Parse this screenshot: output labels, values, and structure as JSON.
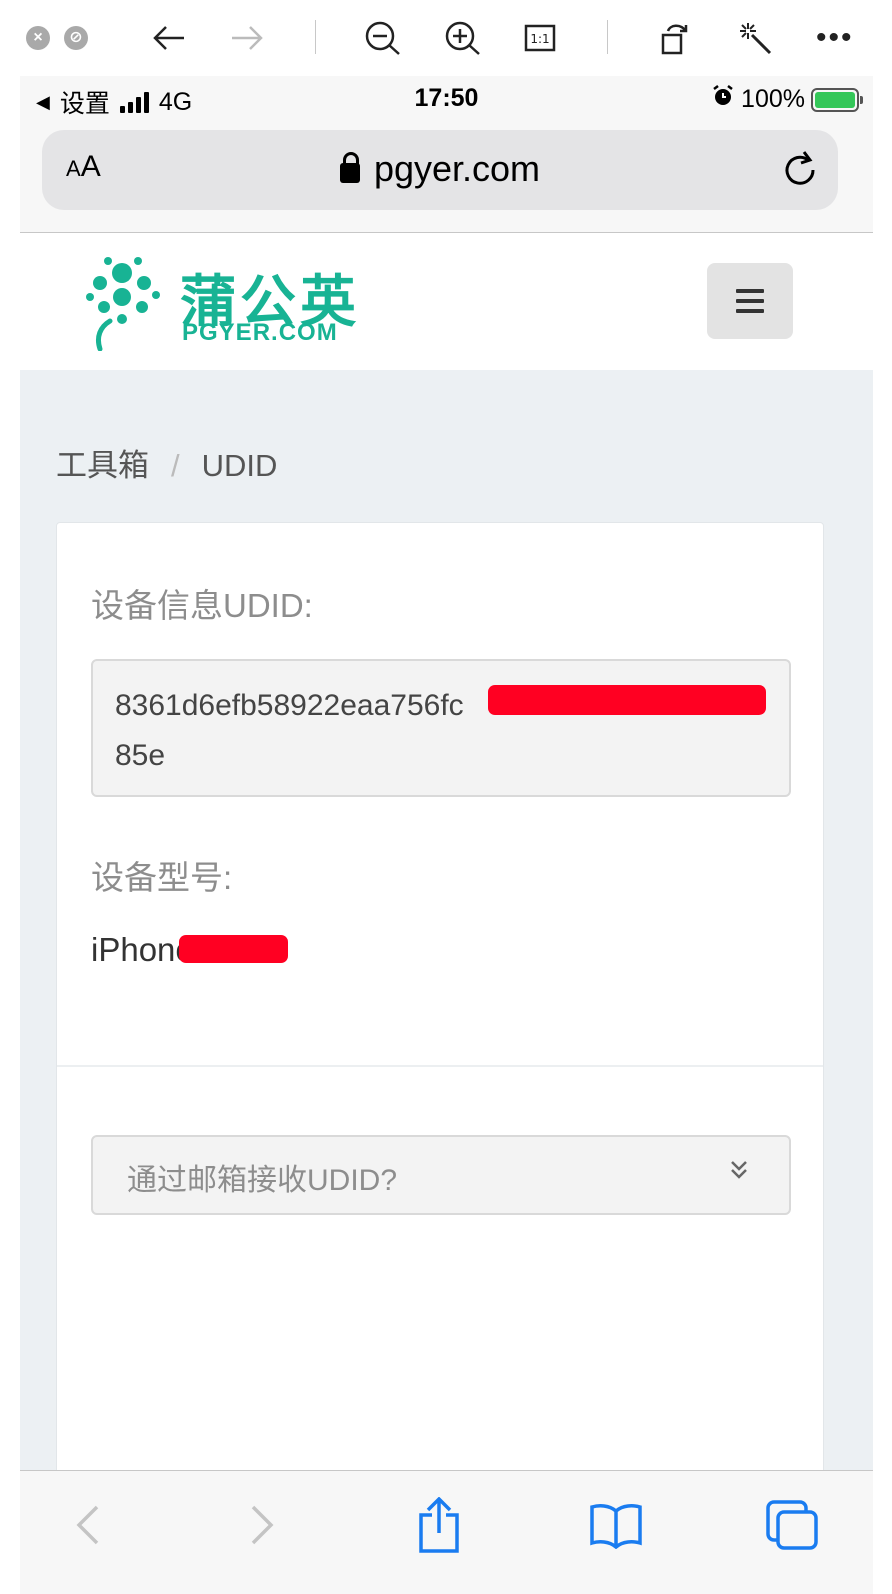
{
  "viewer": {
    "icons": [
      "close-circle-icon",
      "stop-circle-icon",
      "back-arrow-icon",
      "forward-arrow-icon",
      "zoom-out-icon",
      "zoom-in-icon",
      "actual-size-icon",
      "rotate-icon",
      "magic-wand-icon",
      "more-icon"
    ]
  },
  "status": {
    "back_app": "设置",
    "network": "4G",
    "time": "17:50",
    "battery": "100%"
  },
  "url_bar": {
    "text_size_label_small": "A",
    "text_size_label_large": "A",
    "host": "pgyer.com"
  },
  "site": {
    "logo_cn": "蒲公英",
    "logo_en": "PGYER.COM",
    "brand_color": "#18b394"
  },
  "breadcrumb": {
    "parent": "工具箱",
    "separator": "/",
    "current": "UDID"
  },
  "device": {
    "udid_label": "设备信息UDID:",
    "udid_value": "8361d6efb58922eaa756fc\n85e",
    "model_label": "设备型号:",
    "model_value": "iPhone"
  },
  "email_toggle": {
    "label": "通过邮箱接收UDID?"
  },
  "bottom_bar": {
    "icons": [
      "back-icon",
      "forward-icon",
      "share-icon",
      "bookmarks-icon",
      "tabs-icon"
    ]
  }
}
